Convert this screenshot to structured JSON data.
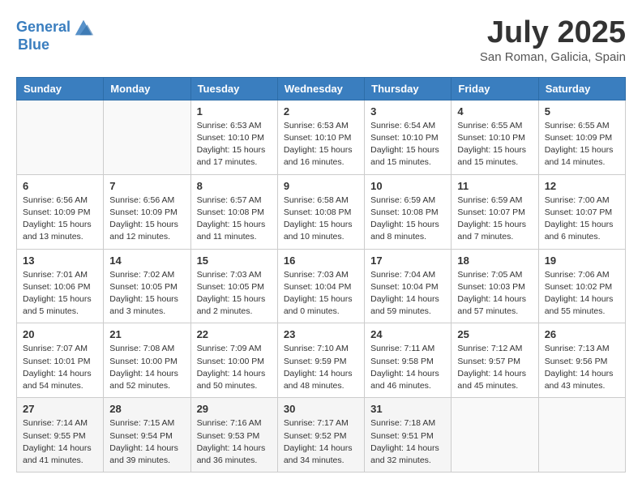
{
  "header": {
    "logo_line1": "General",
    "logo_line2": "Blue",
    "month": "July 2025",
    "location": "San Roman, Galicia, Spain"
  },
  "weekdays": [
    "Sunday",
    "Monday",
    "Tuesday",
    "Wednesday",
    "Thursday",
    "Friday",
    "Saturday"
  ],
  "weeks": [
    [
      {
        "day": "",
        "info": ""
      },
      {
        "day": "",
        "info": ""
      },
      {
        "day": "1",
        "info": "Sunrise: 6:53 AM\nSunset: 10:10 PM\nDaylight: 15 hours\nand 17 minutes."
      },
      {
        "day": "2",
        "info": "Sunrise: 6:53 AM\nSunset: 10:10 PM\nDaylight: 15 hours\nand 16 minutes."
      },
      {
        "day": "3",
        "info": "Sunrise: 6:54 AM\nSunset: 10:10 PM\nDaylight: 15 hours\nand 15 minutes."
      },
      {
        "day": "4",
        "info": "Sunrise: 6:55 AM\nSunset: 10:10 PM\nDaylight: 15 hours\nand 15 minutes."
      },
      {
        "day": "5",
        "info": "Sunrise: 6:55 AM\nSunset: 10:09 PM\nDaylight: 15 hours\nand 14 minutes."
      }
    ],
    [
      {
        "day": "6",
        "info": "Sunrise: 6:56 AM\nSunset: 10:09 PM\nDaylight: 15 hours\nand 13 minutes."
      },
      {
        "day": "7",
        "info": "Sunrise: 6:56 AM\nSunset: 10:09 PM\nDaylight: 15 hours\nand 12 minutes."
      },
      {
        "day": "8",
        "info": "Sunrise: 6:57 AM\nSunset: 10:08 PM\nDaylight: 15 hours\nand 11 minutes."
      },
      {
        "day": "9",
        "info": "Sunrise: 6:58 AM\nSunset: 10:08 PM\nDaylight: 15 hours\nand 10 minutes."
      },
      {
        "day": "10",
        "info": "Sunrise: 6:59 AM\nSunset: 10:08 PM\nDaylight: 15 hours\nand 8 minutes."
      },
      {
        "day": "11",
        "info": "Sunrise: 6:59 AM\nSunset: 10:07 PM\nDaylight: 15 hours\nand 7 minutes."
      },
      {
        "day": "12",
        "info": "Sunrise: 7:00 AM\nSunset: 10:07 PM\nDaylight: 15 hours\nand 6 minutes."
      }
    ],
    [
      {
        "day": "13",
        "info": "Sunrise: 7:01 AM\nSunset: 10:06 PM\nDaylight: 15 hours\nand 5 minutes."
      },
      {
        "day": "14",
        "info": "Sunrise: 7:02 AM\nSunset: 10:05 PM\nDaylight: 15 hours\nand 3 minutes."
      },
      {
        "day": "15",
        "info": "Sunrise: 7:03 AM\nSunset: 10:05 PM\nDaylight: 15 hours\nand 2 minutes."
      },
      {
        "day": "16",
        "info": "Sunrise: 7:03 AM\nSunset: 10:04 PM\nDaylight: 15 hours\nand 0 minutes."
      },
      {
        "day": "17",
        "info": "Sunrise: 7:04 AM\nSunset: 10:04 PM\nDaylight: 14 hours\nand 59 minutes."
      },
      {
        "day": "18",
        "info": "Sunrise: 7:05 AM\nSunset: 10:03 PM\nDaylight: 14 hours\nand 57 minutes."
      },
      {
        "day": "19",
        "info": "Sunrise: 7:06 AM\nSunset: 10:02 PM\nDaylight: 14 hours\nand 55 minutes."
      }
    ],
    [
      {
        "day": "20",
        "info": "Sunrise: 7:07 AM\nSunset: 10:01 PM\nDaylight: 14 hours\nand 54 minutes."
      },
      {
        "day": "21",
        "info": "Sunrise: 7:08 AM\nSunset: 10:00 PM\nDaylight: 14 hours\nand 52 minutes."
      },
      {
        "day": "22",
        "info": "Sunrise: 7:09 AM\nSunset: 10:00 PM\nDaylight: 14 hours\nand 50 minutes."
      },
      {
        "day": "23",
        "info": "Sunrise: 7:10 AM\nSunset: 9:59 PM\nDaylight: 14 hours\nand 48 minutes."
      },
      {
        "day": "24",
        "info": "Sunrise: 7:11 AM\nSunset: 9:58 PM\nDaylight: 14 hours\nand 46 minutes."
      },
      {
        "day": "25",
        "info": "Sunrise: 7:12 AM\nSunset: 9:57 PM\nDaylight: 14 hours\nand 45 minutes."
      },
      {
        "day": "26",
        "info": "Sunrise: 7:13 AM\nSunset: 9:56 PM\nDaylight: 14 hours\nand 43 minutes."
      }
    ],
    [
      {
        "day": "27",
        "info": "Sunrise: 7:14 AM\nSunset: 9:55 PM\nDaylight: 14 hours\nand 41 minutes."
      },
      {
        "day": "28",
        "info": "Sunrise: 7:15 AM\nSunset: 9:54 PM\nDaylight: 14 hours\nand 39 minutes."
      },
      {
        "day": "29",
        "info": "Sunrise: 7:16 AM\nSunset: 9:53 PM\nDaylight: 14 hours\nand 36 minutes."
      },
      {
        "day": "30",
        "info": "Sunrise: 7:17 AM\nSunset: 9:52 PM\nDaylight: 14 hours\nand 34 minutes."
      },
      {
        "day": "31",
        "info": "Sunrise: 7:18 AM\nSunset: 9:51 PM\nDaylight: 14 hours\nand 32 minutes."
      },
      {
        "day": "",
        "info": ""
      },
      {
        "day": "",
        "info": ""
      }
    ]
  ]
}
